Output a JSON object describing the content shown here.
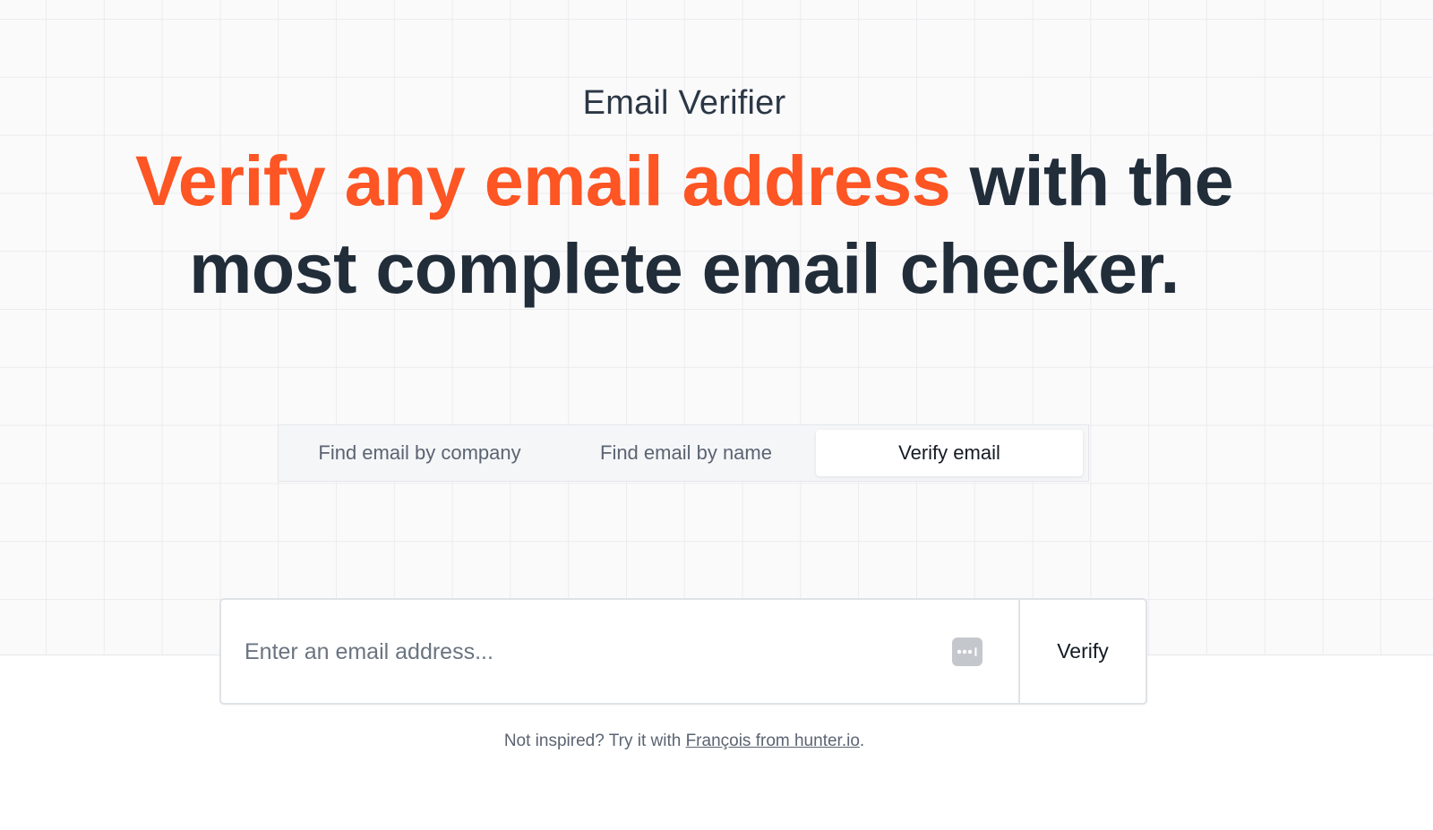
{
  "hero": {
    "eyebrow": "Email Verifier",
    "headline_accent": "Verify any email address",
    "headline_rest": " with the most complete email checker."
  },
  "tabs": [
    {
      "label": "Find email by company",
      "active": false
    },
    {
      "label": "Find email by name",
      "active": false
    },
    {
      "label": "Verify email",
      "active": true
    }
  ],
  "search": {
    "placeholder": "Enter an email address...",
    "value": "",
    "button_label": "Verify",
    "autofill_icon": "password-autofill-icon"
  },
  "hint": {
    "prefix": "Not inspired? Try it with ",
    "link_text": "François from hunter.io",
    "suffix": "."
  },
  "colors": {
    "accent": "#fd5523",
    "heading": "#222d3a",
    "muted": "#5b6472"
  }
}
